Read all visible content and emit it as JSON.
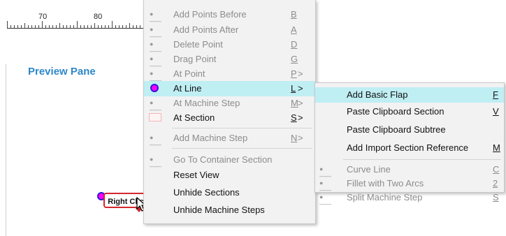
{
  "ruler": {
    "labels": [
      "70",
      "80"
    ]
  },
  "preview": {
    "title": "Preview Pane"
  },
  "callout": {
    "text": "Right Click"
  },
  "main_menu": {
    "items": [
      {
        "label": "Add Points Before",
        "key": "B",
        "arrow": "",
        "state": "disabled",
        "icon": "key-icon"
      },
      {
        "label": "Add Points After",
        "key": "A",
        "arrow": "",
        "state": "disabled",
        "icon": "key-icon"
      },
      {
        "label": "Delete Point",
        "key": "D",
        "arrow": "",
        "state": "disabled",
        "icon": "key-icon"
      },
      {
        "label": "Drag Point",
        "key": "G",
        "arrow": "",
        "state": "disabled",
        "icon": "key-icon"
      },
      {
        "label": "At Point",
        "key": "P",
        "arrow": ">",
        "state": "disabled",
        "icon": "key-icon"
      },
      {
        "label": "At Line",
        "key": "L",
        "arrow": ">",
        "state": "highlighted",
        "icon": "radio-icon"
      },
      {
        "label": "At Machine Step",
        "key": "M",
        "arrow": ">",
        "state": "disabled",
        "icon": "key-icon"
      },
      {
        "label": "At Section",
        "key": "S",
        "arrow": ">",
        "state": "enabled",
        "icon": "section-icon"
      },
      {
        "label": "Add Machine Step",
        "key": "N",
        "arrow": ">",
        "state": "disabled",
        "icon": "key-icon"
      },
      {
        "label": "Go To Container Section",
        "key": "",
        "arrow": "",
        "state": "disabled",
        "icon": "key-icon"
      },
      {
        "label": "Reset View",
        "key": "",
        "arrow": "",
        "state": "enabled",
        "icon": ""
      },
      {
        "label": "Unhide Sections",
        "key": "",
        "arrow": "",
        "state": "enabled",
        "icon": ""
      },
      {
        "label": "Unhide Machine Steps",
        "key": "",
        "arrow": "",
        "state": "enabled",
        "icon": ""
      }
    ]
  },
  "sub_menu": {
    "items": [
      {
        "label": "Add Basic Flap",
        "key": "F",
        "state": "highlighted",
        "icon": ""
      },
      {
        "label": "Paste Clipboard Section",
        "key": "V",
        "state": "enabled",
        "icon": ""
      },
      {
        "label": "Paste Clipboard Subtree",
        "key": "",
        "state": "enabled",
        "icon": ""
      },
      {
        "label": "Add Import Section Reference",
        "key": "M",
        "state": "enabled",
        "icon": ""
      },
      {
        "label": "Curve Line",
        "key": "C",
        "state": "disabled",
        "icon": "key-icon"
      },
      {
        "label": "Fillet with Two Arcs",
        "key": "2",
        "state": "disabled",
        "icon": "key-icon"
      },
      {
        "label": "Split Machine Step",
        "key": "S",
        "state": "disabled",
        "icon": "key-icon"
      }
    ]
  },
  "colors": {
    "highlight": "#bfeef3",
    "title_blue": "#2d87c9",
    "callout_red": "#d4272e",
    "node_magenta": "#ff00ff"
  }
}
